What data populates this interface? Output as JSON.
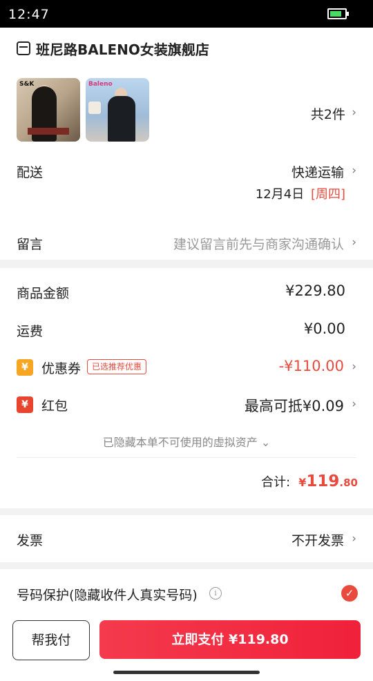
{
  "status_bar": {
    "time": "12:47"
  },
  "store": {
    "name": "班尼路BALENO女装旗舰店"
  },
  "products": {
    "count_label": "共2件",
    "thumb1_badge": "S&K",
    "thumb2_badge": "Baleno"
  },
  "shipping": {
    "label": "配送",
    "method": "快递运输",
    "date": "12月4日",
    "weekday": "[周四]"
  },
  "message": {
    "label": "留言",
    "placeholder": "建议留言前先与商家沟通确认"
  },
  "summary": {
    "goods_label": "商品金额",
    "goods_value": "¥229.80",
    "freight_label": "运费",
    "freight_value": "¥0.00",
    "coupon_label": "优惠券",
    "coupon_tag": "已选推荐优惠",
    "coupon_value": "-¥110.00",
    "redpack_label": "红包",
    "redpack_value": "最高可抵¥0.09",
    "hidden_assets": "已隐藏本单不可使用的虚拟资产",
    "total_label": "合计:",
    "total_currency": "¥",
    "total_int": "119",
    "total_dec": ".80"
  },
  "invoice": {
    "label": "发票",
    "value": "不开发票"
  },
  "privacy": {
    "label": "号码保护(隐藏收件人真实号码)",
    "checked": true
  },
  "actions": {
    "help_pay": "帮我付",
    "pay_now": "立即支付 ¥119.80"
  },
  "colors": {
    "accent": "#f0213a",
    "price_red": "#e94a3d"
  }
}
